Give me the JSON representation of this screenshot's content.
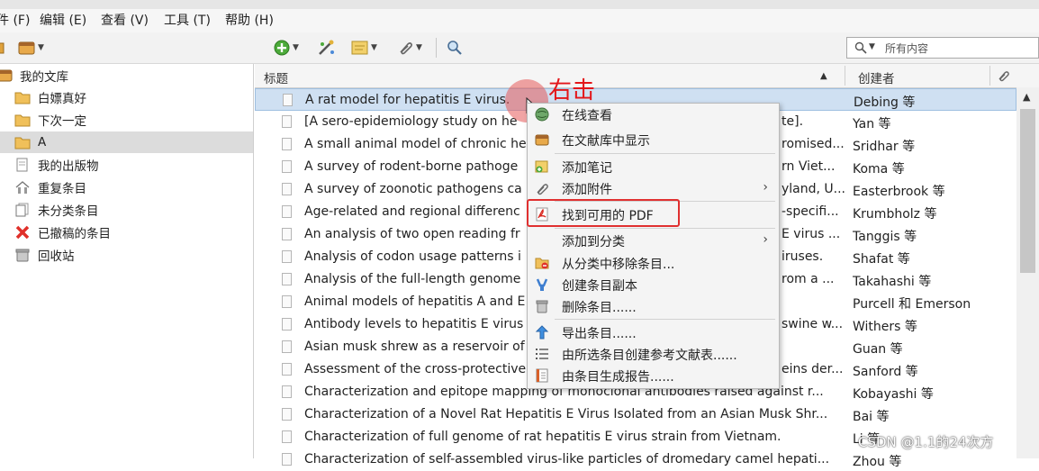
{
  "menubar": {
    "items": [
      "件 (F)",
      "编辑 (E)",
      "查看 (V)",
      "工具 (T)",
      "帮助 (H)"
    ]
  },
  "search": {
    "placeholder": "所有内容"
  },
  "sidebar": {
    "items": [
      {
        "label": "我的文库",
        "icon": "library-icon",
        "indent": 0
      },
      {
        "label": "白嫖真好",
        "icon": "folder-icon",
        "indent": 1
      },
      {
        "label": "下次一定",
        "icon": "folder-icon",
        "indent": 1
      },
      {
        "label": "A",
        "icon": "folder-icon",
        "indent": 1,
        "selected": true
      },
      {
        "label": "我的出版物",
        "icon": "publications-icon",
        "indent": 1
      },
      {
        "label": "重复条目",
        "icon": "duplicates-icon",
        "indent": 1
      },
      {
        "label": "未分类条目",
        "icon": "unfiled-icon",
        "indent": 1
      },
      {
        "label": "已撤稿的条目",
        "icon": "retracted-icon",
        "indent": 1
      },
      {
        "label": "回收站",
        "icon": "trash-icon",
        "indent": 1
      }
    ]
  },
  "items_table": {
    "headers": {
      "title": "标题",
      "creator": "创建者"
    },
    "rows": [
      {
        "title": "A rat model for hepatitis E virus.",
        "creator": "Debing 等"
      },
      {
        "title": "[A sero-epidemiology study on he",
        "creator": "Yan 等",
        "title_tail": "te]."
      },
      {
        "title": "A small animal model of chronic he",
        "creator": "Sridhar 等",
        "title_tail": "romised..."
      },
      {
        "title": "A survey of rodent-borne pathoge",
        "creator": "Koma 等",
        "title_tail": "rn Viet..."
      },
      {
        "title": "A survey of zoonotic pathogens ca",
        "creator": "Easterbrook 等",
        "title_tail": "yland, U..."
      },
      {
        "title": "Age-related and regional differenc",
        "creator": "Krumbholz 等",
        "title_tail": "-specifi..."
      },
      {
        "title": "An analysis of two open reading fr",
        "creator": "Tanggis 等",
        "title_tail": "E virus ..."
      },
      {
        "title": "Analysis of codon usage patterns i",
        "creator": "Shafat 等",
        "title_tail": "iruses."
      },
      {
        "title": "Analysis of the full-length genome",
        "creator": "Takahashi 等",
        "title_tail": "rom a ..."
      },
      {
        "title": "Animal models of hepatitis A and E",
        "creator": "Purcell 和 Emerson",
        "title_tail": ""
      },
      {
        "title": "Antibody levels to hepatitis E virus",
        "creator": "Withers 等",
        "title_tail": "swine w..."
      },
      {
        "title": "Asian musk shrew as a reservoir of",
        "creator": "Guan 等",
        "title_tail": ""
      },
      {
        "title": "Assessment of the cross-protective",
        "creator": "Sanford 等",
        "title_tail": "eins der..."
      },
      {
        "title": "Characterization and epitope mapping of monoclonal antibodies raised against r...",
        "creator": "Kobayashi 等"
      },
      {
        "title": "Characterization of a Novel Rat Hepatitis E Virus Isolated from an Asian Musk Shr...",
        "creator": "Bai 等"
      },
      {
        "title": "Characterization of full genome of rat hepatitis E virus strain from Vietnam.",
        "creator": "Li 等"
      },
      {
        "title": "Characterization of self-assembled virus-like particles of dromedary camel hepati...",
        "creator": "Zhou 等"
      }
    ]
  },
  "context_menu": {
    "items": [
      {
        "label": "在线查看",
        "icon": "view-online-icon",
        "submenu": false
      },
      {
        "label": "在文献库中显示",
        "icon": "show-in-library-icon",
        "submenu": false
      },
      {
        "label": "添加笔记",
        "icon": "add-note-icon",
        "submenu": false
      },
      {
        "label": "添加附件",
        "icon": "paperclip-icon",
        "submenu": true
      },
      {
        "label": "找到可用的 PDF",
        "icon": "pdf-icon",
        "submenu": false
      },
      {
        "label": "添加到分类",
        "icon": "",
        "submenu": true
      },
      {
        "label": "从分类中移除条目...",
        "icon": "remove-from-collection-icon",
        "submenu": false
      },
      {
        "label": "创建条目副本",
        "icon": "duplicate-item-icon",
        "submenu": false
      },
      {
        "label": "删除条目......",
        "icon": "trash-icon",
        "submenu": false
      },
      {
        "label": "导出条目......",
        "icon": "export-icon",
        "submenu": false
      },
      {
        "label": "由所选条目创建参考文献表......",
        "icon": "bibliography-icon",
        "submenu": false
      },
      {
        "label": "由条目生成报告......",
        "icon": "report-icon",
        "submenu": false
      }
    ],
    "submenu_arrow": "›"
  },
  "annotation": {
    "text": "右击",
    "color": "#e3161a"
  },
  "watermark": {
    "text": "CSDN @1.1的24次方"
  },
  "colors": {
    "selection": "#cfe0f2",
    "highlight_box": "#e03030",
    "folder": "#e8b84a"
  }
}
